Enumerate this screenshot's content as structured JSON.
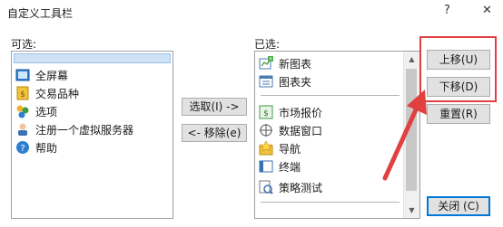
{
  "window": {
    "title": "自定义工具栏",
    "help_glyph": "?",
    "close_glyph": "✕"
  },
  "left": {
    "label": "可选:",
    "items": [
      {
        "label": "全屏幕",
        "icon": "fullscreen-icon"
      },
      {
        "label": "交易品种",
        "icon": "symbols-icon"
      },
      {
        "label": "选项",
        "icon": "options-icon"
      },
      {
        "label": "注册一个虚拟服务器",
        "icon": "virtual-server-icon"
      },
      {
        "label": "帮助",
        "icon": "help-icon"
      }
    ]
  },
  "middle": {
    "add_label": "选取(I) ->",
    "remove_label": "<- 移除(e)"
  },
  "right": {
    "label": "已选:",
    "items": [
      {
        "label": "新图表",
        "icon": "new-chart-icon"
      },
      {
        "label": "图表夹",
        "icon": "profiles-icon"
      },
      {
        "label": "市场报价",
        "icon": "market-watch-icon"
      },
      {
        "label": "数据窗口",
        "icon": "data-window-icon"
      },
      {
        "label": "导航",
        "icon": "navigator-icon"
      },
      {
        "label": "终端",
        "icon": "terminal-icon"
      },
      {
        "label": "策略测试",
        "icon": "strategy-tester-icon"
      }
    ]
  },
  "buttons": {
    "up": "上移(U)",
    "down": "下移(D)",
    "reset": "重置(R)",
    "close": "关闭 (C)"
  },
  "colors": {
    "accent": "#0078d7",
    "highlight": "#e24040",
    "selection": "#cfe3f6"
  }
}
